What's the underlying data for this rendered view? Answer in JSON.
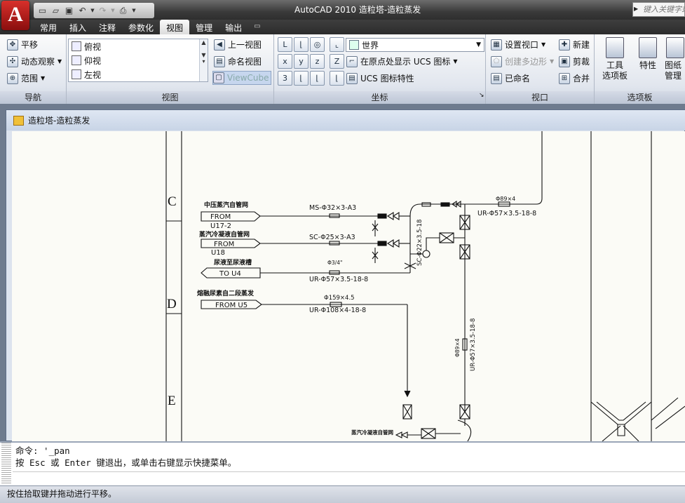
{
  "titlebar": {
    "app_title": "AutoCAD 2010    造粒塔-造粒蒸发",
    "search_placeholder": "键入关键字或短语"
  },
  "quick_access": [
    "new-icon",
    "open-icon",
    "save-icon",
    "undo-icon",
    "redo-icon",
    "plot-icon"
  ],
  "tabs": [
    {
      "label": "常用"
    },
    {
      "label": "插入"
    },
    {
      "label": "注释"
    },
    {
      "label": "参数化"
    },
    {
      "label": "视图",
      "active": true
    },
    {
      "label": "管理"
    },
    {
      "label": "输出"
    }
  ],
  "ribbon": {
    "nav": {
      "title": "导航",
      "pan": "平移",
      "orbit": "动态观察",
      "extents": "范围"
    },
    "view": {
      "title": "视图",
      "list": [
        "俯视",
        "仰视",
        "左视"
      ],
      "prev": "上一视图",
      "named": "命名视图",
      "viewcube": "ViewCube"
    },
    "coords": {
      "title": "坐标",
      "world": "世界",
      "ucs_icon_origin": "在原点处显示 UCS 图标",
      "ucs_props": "UCS 图标特性"
    },
    "viewport": {
      "title": "视口",
      "setup": "设置视口",
      "polygon": "创建多边形",
      "named": "已命名",
      "new": "新建",
      "clip": "剪裁",
      "merge": "合并"
    },
    "palettes": {
      "title": "选项板",
      "tool": "工具\n选项板",
      "props": "特性",
      "sheet": "图纸\n管理"
    }
  },
  "drawing": {
    "window_title": "造粒塔-造粒蒸发",
    "zones": [
      "C",
      "D",
      "E"
    ],
    "labels": {
      "l1_title": "中压蒸汽自管网",
      "l1_tag": "FROM",
      "l1_sub": "U17-2",
      "l1_spec": "MS-Φ32×3-A3",
      "l2_title": "蒸汽冷凝液自管网",
      "l2_tag": "FROM",
      "l2_sub": "U18",
      "l2_spec": "SC-Φ25×3-A3",
      "l3_title": "尿液至尿液槽",
      "l3_tag": "TO U4",
      "l3_small": "Φ3/4\"",
      "l3_spec": "UR-Φ57×3.5-18-8",
      "l4_title": "熔融尿素自二段蒸发",
      "l4_tag": "FROM U5",
      "l4_small": "Φ159×4.5",
      "l4_spec": "UR-Φ108×4-18-8",
      "top_small": "Φ89×4",
      "top_spec": "UR-Φ57×3.5-18-8",
      "vert_spec1": "SC-Φ22×3.5-18",
      "vert_spec2": "UR-Φ57×3.5-18-8",
      "vert_small": "Φ89×4",
      "bottom_title": "蒸汽冷凝液自管网"
    }
  },
  "command": {
    "line1": "命令: '_pan",
    "line2": "按 Esc 或 Enter 键退出，或单击右键显示快捷菜单。"
  },
  "status": "按住拾取键并拖动进行平移。"
}
